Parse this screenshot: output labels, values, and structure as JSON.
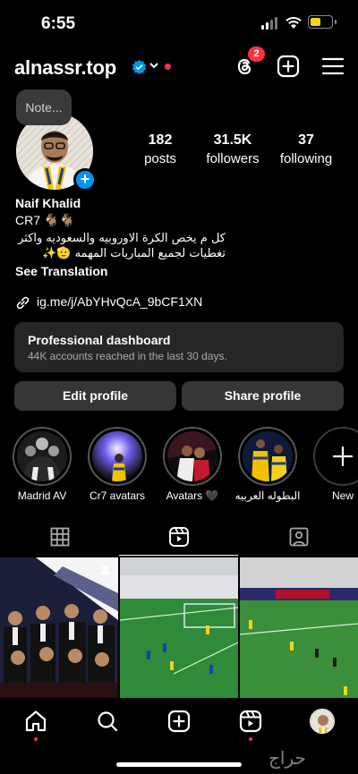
{
  "status_bar": {
    "time": "6:55"
  },
  "header": {
    "username": "alnassr.top",
    "threads_badge": "2",
    "icons": [
      "verified-icon",
      "chevron-down-icon",
      "threads-icon",
      "create-icon",
      "menu-icon"
    ]
  },
  "profile": {
    "note": "Note...",
    "stats": [
      {
        "value": "182",
        "label": "posts"
      },
      {
        "value": "31.5K",
        "label": "followers"
      },
      {
        "value": "37",
        "label": "following"
      }
    ],
    "name": "Naif Khalid",
    "bio_line1": "CR7 🐐🐐",
    "bio_line2": "كل م يخص الكرة الاوروبيه والسعوديه واكثر",
    "bio_line3": "تغطيات لجميع المباريات المهمه 🫡✨",
    "see_translation": "See Translation",
    "link": "ig.me/j/AbYHvQcA_9bCF1XN"
  },
  "dashboard": {
    "title": "Professional dashboard",
    "subtitle": "44K accounts reached in the last 30 days."
  },
  "buttons": {
    "edit": "Edit profile",
    "share": "Share profile"
  },
  "highlights": [
    {
      "label": "Madrid AV"
    },
    {
      "label": "Cr7 avatars"
    },
    {
      "label": "Avatars 🖤"
    },
    {
      "label": "البطوله العربيه"
    },
    {
      "label": "New"
    }
  ],
  "tabs": [
    "grid-icon",
    "reels-icon",
    "tagged-icon"
  ],
  "nav": [
    "home-icon",
    "search-icon",
    "create-icon",
    "reels-icon",
    "profile-avatar"
  ],
  "watermark": "حراج",
  "colors": {
    "accent": "#0095f6",
    "notification": "#ff3040",
    "surface": "#262626",
    "button": "#363636"
  }
}
